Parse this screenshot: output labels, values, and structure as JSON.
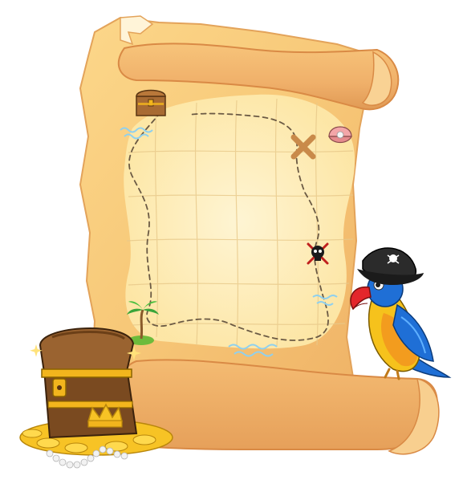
{
  "scene": {
    "subject": "treasure-map-scroll",
    "colors": {
      "paper_light": "#fde3a0",
      "paper_mid": "#f5c46e",
      "paper_dark": "#e9a95c",
      "paper_edge": "#d9924a",
      "map_glow": "#fff2c4",
      "route": "#6b5a44",
      "x_mark": "#c98a4a",
      "water": "#8fd0ee",
      "chest_wood": "#8a5a2b",
      "chest_gold": "#f2b51d",
      "coins": "#f7c325",
      "pearls": "#f2f2f2",
      "parrot_blue": "#1f6fd6",
      "parrot_red": "#e3262b",
      "parrot_yellow": "#f6c21c",
      "hat": "#2b2b2b"
    },
    "icons": [
      "treasure-chest-icon",
      "x-mark-icon",
      "skull-crossbones-icon",
      "palm-island-icon",
      "shell-pearl-icon",
      "wave-icon",
      "pirate-parrot",
      "gold-coin-pile"
    ]
  }
}
